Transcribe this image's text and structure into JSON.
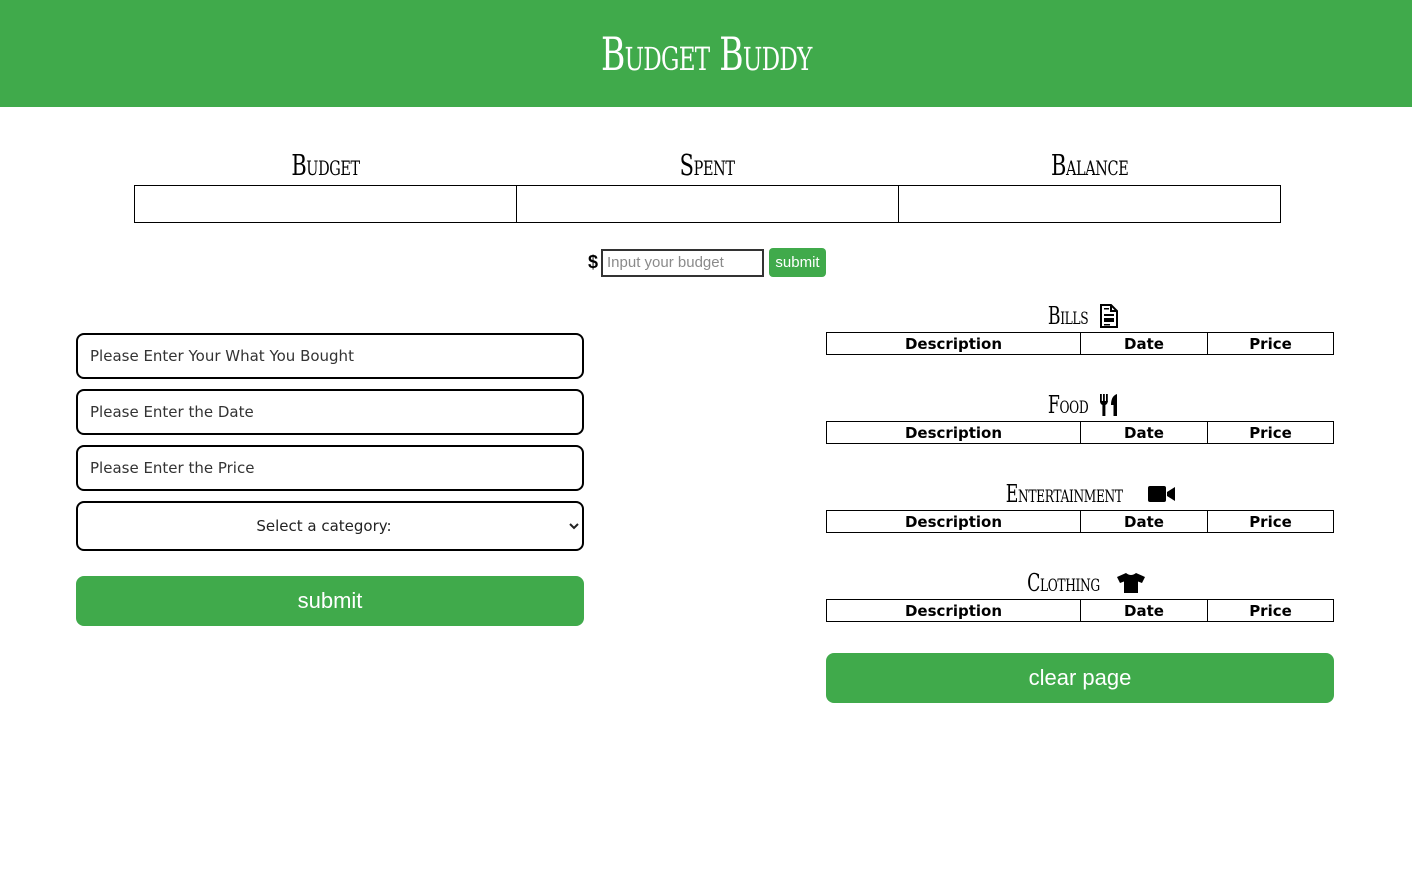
{
  "app": {
    "title": "Budget Buddy"
  },
  "summary": {
    "labels": {
      "budget": "Budget",
      "spent": "Spent",
      "balance": "Balance"
    }
  },
  "budget_entry": {
    "currency_symbol": "$",
    "placeholder": "Input your budget",
    "submit_label": "submit"
  },
  "purchase_form": {
    "description_placeholder": "Please Enter Your What You Bought",
    "date_placeholder": "Please Enter the Date",
    "price_placeholder": "Please Enter the Price",
    "category_select": "Select a category:",
    "submit_label": "submit"
  },
  "categories": [
    {
      "name": "Bills",
      "icon": "file-invoice-icon"
    },
    {
      "name": "Food",
      "icon": "utensils-icon"
    },
    {
      "name": "Entertainment",
      "icon": "video-camera-icon"
    },
    {
      "name": "Clothing",
      "icon": "tshirt-icon"
    }
  ],
  "table_headers": {
    "description": "Description",
    "date": "Date",
    "price": "Price"
  },
  "clear_label": "clear page",
  "colors": {
    "accent": "#40aa4b"
  }
}
